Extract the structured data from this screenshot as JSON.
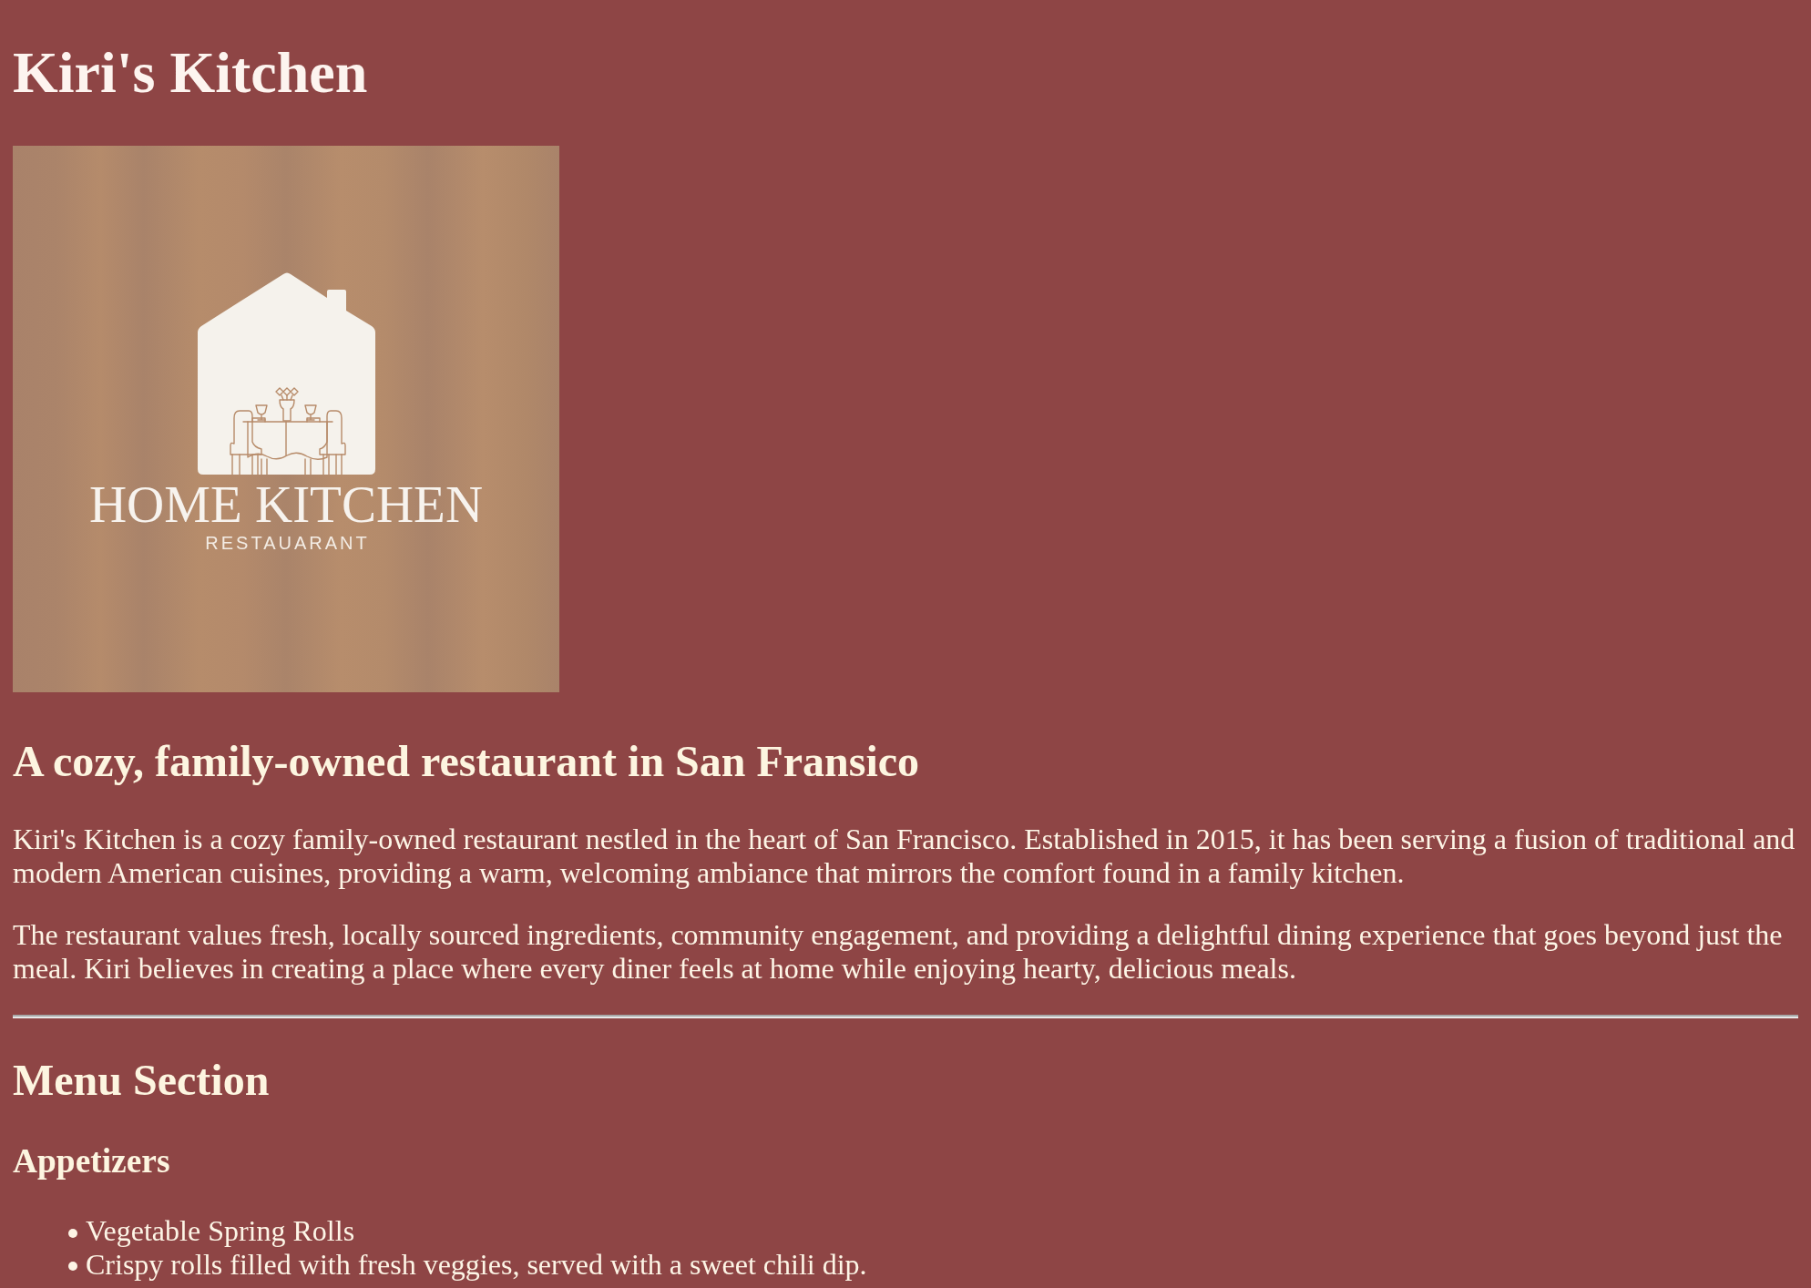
{
  "header": {
    "title": "Kiri's Kitchen"
  },
  "logo": {
    "name": "HOME KITCHEN",
    "tagline": "RESTAUARANT"
  },
  "about": {
    "heading": "A cozy, family-owned restaurant in San Fransico",
    "paragraphs": [
      "Kiri's Kitchen is a cozy family-owned restaurant nestled in the heart of San Francisco. Established in 2015, it has been serving a fusion of traditional and modern American cuisines, providing a warm, welcoming ambiance that mirrors the comfort found in a family kitchen.",
      "The restaurant values fresh, locally sourced ingredients, community engagement, and providing a delightful dining experience that goes beyond just the meal. Kiri believes in creating a place where every diner feels at home while enjoying hearty, delicious meals."
    ]
  },
  "menu": {
    "heading": "Menu Section",
    "categories": [
      {
        "name": "Appetizers",
        "items": [
          "Vegetable Spring Rolls",
          "Crispy rolls filled with fresh veggies, served with a sweet chili dip."
        ]
      }
    ]
  }
}
